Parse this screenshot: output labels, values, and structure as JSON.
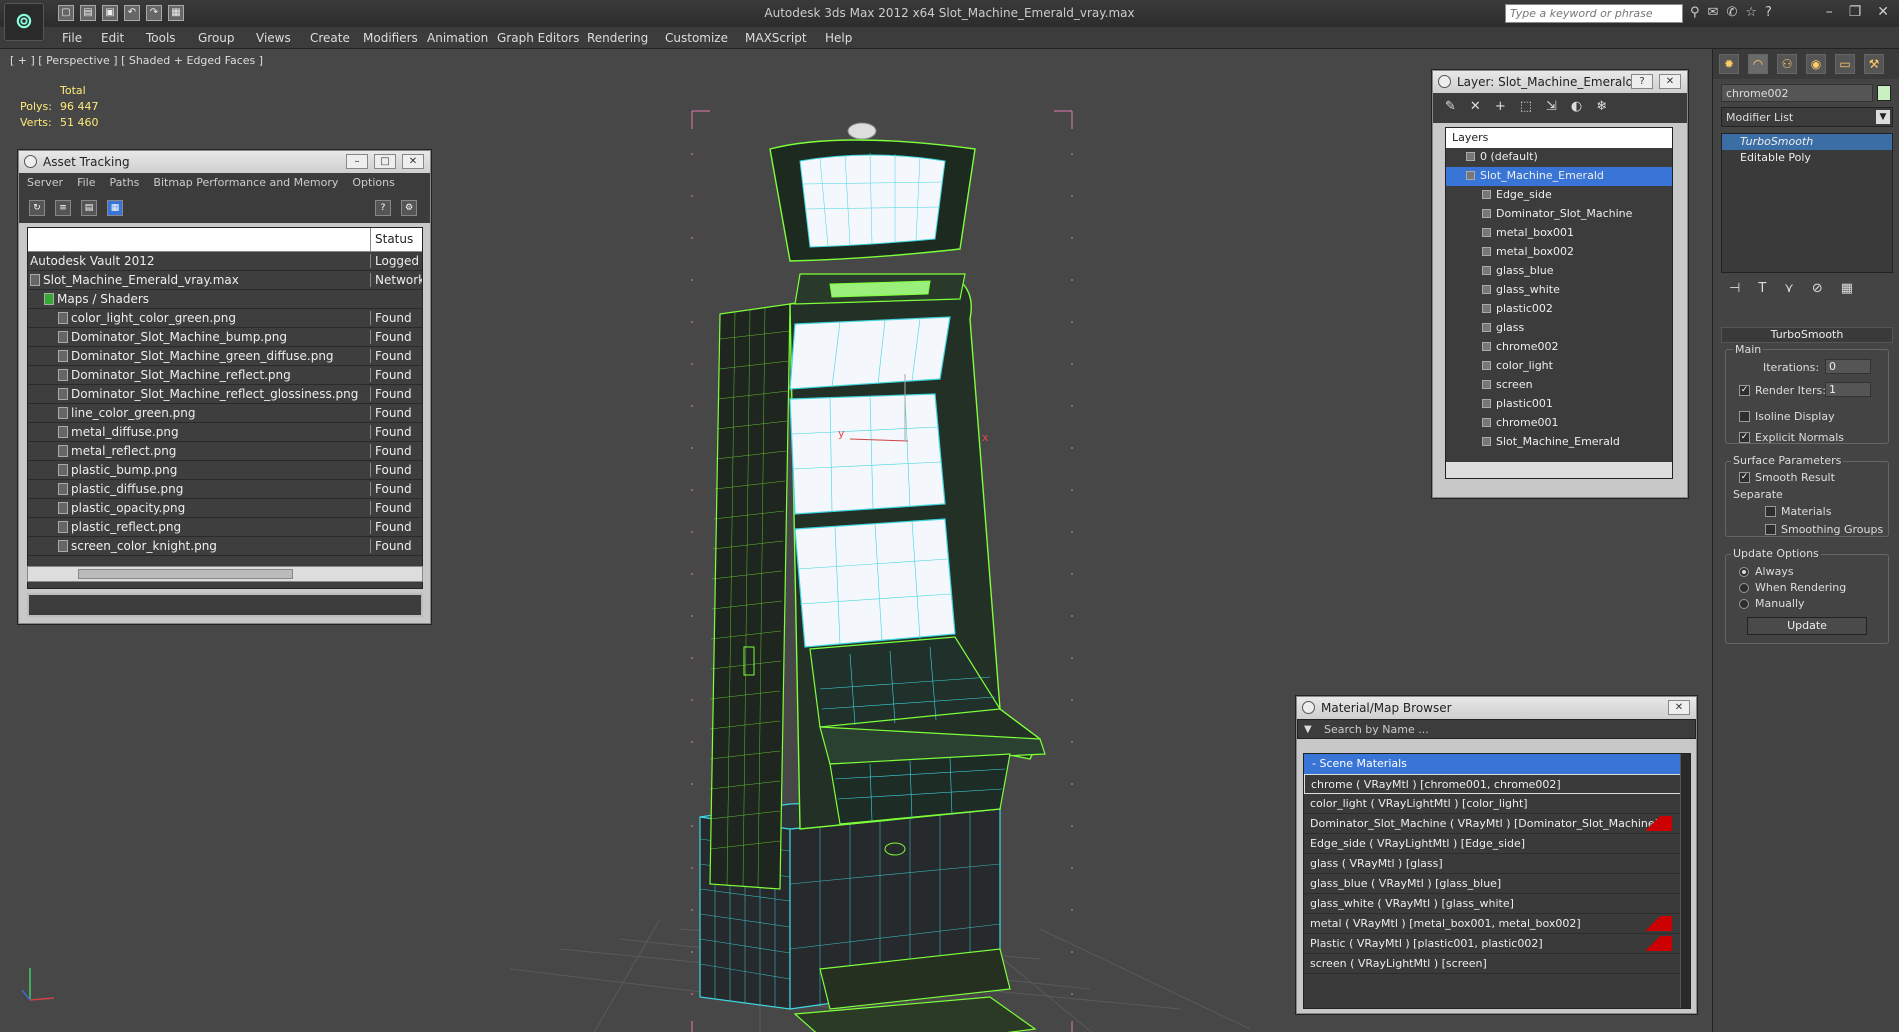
{
  "app": {
    "title": "Autodesk 3ds Max  2012 x64      Slot_Machine_Emerald_vray.max",
    "search_placeholder": "Type a keyword or phrase"
  },
  "menu": [
    "File",
    "Edit",
    "Tools",
    "Group",
    "Views",
    "Create",
    "Modifiers",
    "Animation",
    "Graph Editors",
    "Rendering",
    "Customize",
    "MAXScript",
    "Help"
  ],
  "viewport": {
    "label": "[ + ] [ Perspective ] [ Shaded + Edged Faces ]",
    "stats": {
      "total_label": "Total",
      "polys_label": "Polys:",
      "polys": "96 447",
      "verts_label": "Verts:",
      "verts": "51 460"
    },
    "axis_x": "x",
    "axis_y": "y"
  },
  "asset_tracking": {
    "title": "Asset Tracking",
    "menu": [
      "Server",
      "File",
      "Paths",
      "Bitmap Performance and Memory",
      "Options"
    ],
    "status_header": "Status",
    "rows": [
      {
        "name": "Autodesk Vault 2012",
        "status": "Logged C"
      },
      {
        "name": "Slot_Machine_Emerald_vray.max",
        "status": "Network"
      },
      {
        "name": "Maps / Shaders",
        "status": ""
      },
      {
        "name": "color_light_color_green.png",
        "status": "Found"
      },
      {
        "name": "Dominator_Slot_Machine_bump.png",
        "status": "Found"
      },
      {
        "name": "Dominator_Slot_Machine_green_diffuse.png",
        "status": "Found"
      },
      {
        "name": "Dominator_Slot_Machine_reflect.png",
        "status": "Found"
      },
      {
        "name": "Dominator_Slot_Machine_reflect_glossiness.png",
        "status": "Found"
      },
      {
        "name": "line_color_green.png",
        "status": "Found"
      },
      {
        "name": "metal_diffuse.png",
        "status": "Found"
      },
      {
        "name": "metal_reflect.png",
        "status": "Found"
      },
      {
        "name": "plastic_bump.png",
        "status": "Found"
      },
      {
        "name": "plastic_diffuse.png",
        "status": "Found"
      },
      {
        "name": "plastic_opacity.png",
        "status": "Found"
      },
      {
        "name": "plastic_reflect.png",
        "status": "Found"
      },
      {
        "name": "screen_color_knight.png",
        "status": "Found"
      }
    ]
  },
  "layer_window": {
    "title": "Layer: Slot_Machine_Emerald",
    "header": "Layers",
    "layers": [
      "0 (default)",
      "Slot_Machine_Emerald",
      "Edge_side",
      "Dominator_Slot_Machine",
      "metal_box001",
      "metal_box002",
      "glass_blue",
      "glass_white",
      "plastic002",
      "glass",
      "chrome002",
      "color_light",
      "screen",
      "plastic001",
      "chrome001",
      "Slot_Machine_Emerald"
    ]
  },
  "material_browser": {
    "title": "Material/Map Browser",
    "search_placeholder": "Search by Name ...",
    "section": "- Scene Materials",
    "materials": [
      "chrome  ( VRayMtl ) [chrome001, chrome002]",
      "color_light  ( VRayLightMtl ) [color_light]",
      "Dominator_Slot_Machine  ( VRayMtl ) [Dominator_Slot_Machine]",
      "Edge_side  ( VRayLightMtl ) [Edge_side]",
      "glass  ( VRayMtl ) [glass]",
      "glass_blue  ( VRayMtl ) [glass_blue]",
      "glass_white  ( VRayMtl ) [glass_white]",
      "metal  ( VRayMtl ) [metal_box001, metal_box002]",
      "Plastic  ( VRayMtl ) [plastic001, plastic002]",
      "screen  ( VRayLightMtl ) [screen]"
    ]
  },
  "command_panel": {
    "object_name": "chrome002",
    "object_color": "#c8f0c0",
    "modifier_list": "Modifier List",
    "stack": [
      "TurboSmooth",
      "Editable Poly"
    ],
    "rollout": "TurboSmooth",
    "main_label": "Main",
    "iterations_label": "Iterations:",
    "iterations": "0",
    "render_iters_label": "Render Iters:",
    "render_iters": "1",
    "isoline": "Isoline Display",
    "explicit_normals": "Explicit Normals",
    "surface_params": "Surface Parameters",
    "smooth_result": "Smooth Result",
    "separate": "Separate",
    "materials": "Materials",
    "smoothing_groups": "Smoothing Groups",
    "update_options": "Update Options",
    "always": "Always",
    "when_rendering": "When Rendering",
    "manually": "Manually",
    "update_btn": "Update"
  },
  "colors": {
    "wire_green": "#7dff3a",
    "wire_cyan": "#3fd6e0",
    "selection": "#3875d7",
    "stats_yellow": "#ffeb7a"
  }
}
